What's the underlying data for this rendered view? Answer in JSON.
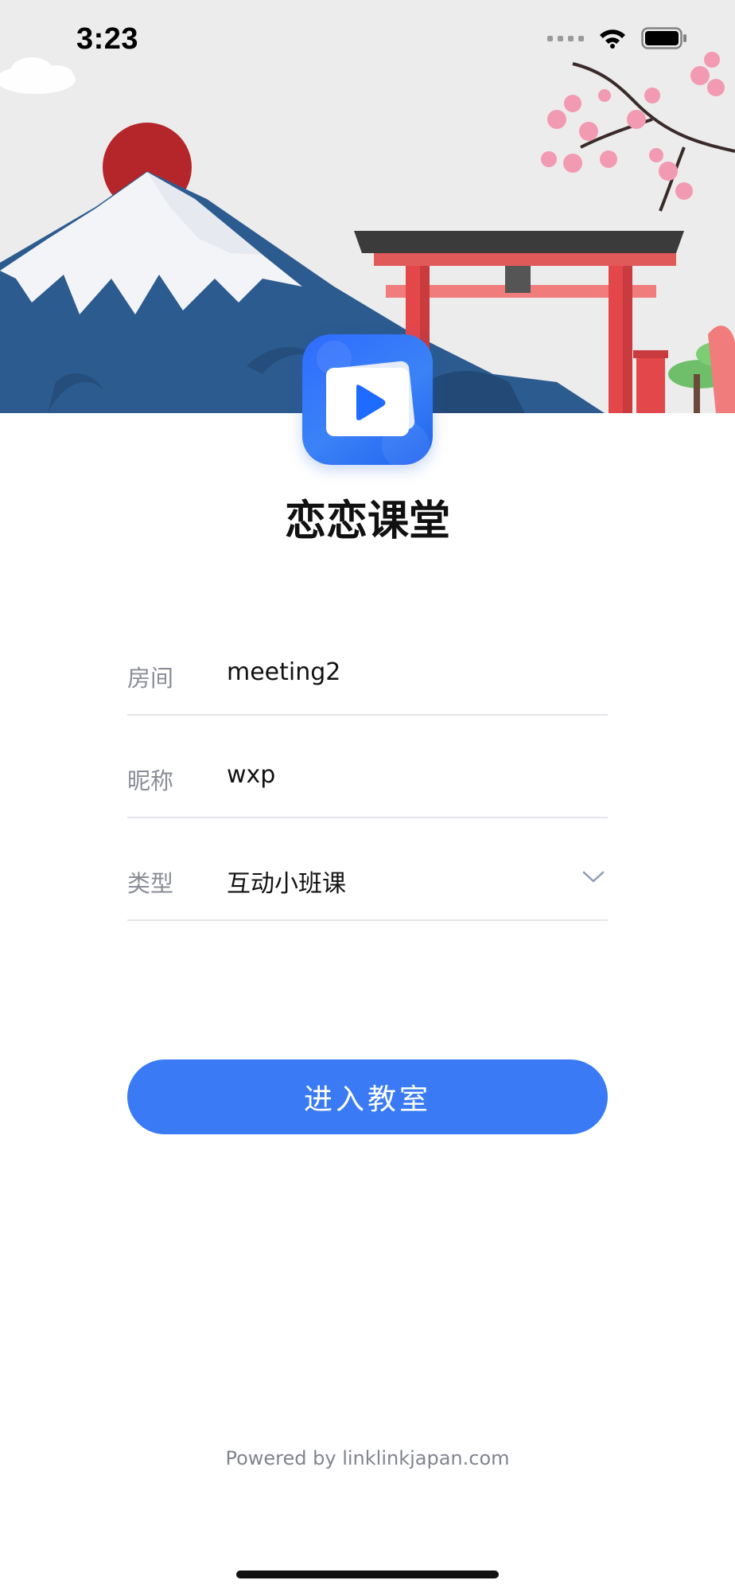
{
  "status_bar": {
    "time": "3:23"
  },
  "app": {
    "title": "恋恋课堂"
  },
  "form": {
    "room": {
      "label": "房间",
      "value": "meeting2"
    },
    "nickname": {
      "label": "昵称",
      "value": "wxp"
    },
    "type": {
      "label": "类型",
      "selected": "互动小班课"
    }
  },
  "enter_button": {
    "label": "进入教室"
  },
  "footer": {
    "powered_by": "Powered by linklinkjapan.com"
  },
  "colors": {
    "accent": "#3a7bf5",
    "label_gray": "#8a8d96",
    "divider": "#e2e4e8"
  },
  "icons": [
    "wifi-icon",
    "battery-icon",
    "app-play-icon",
    "chevron-down-icon"
  ]
}
